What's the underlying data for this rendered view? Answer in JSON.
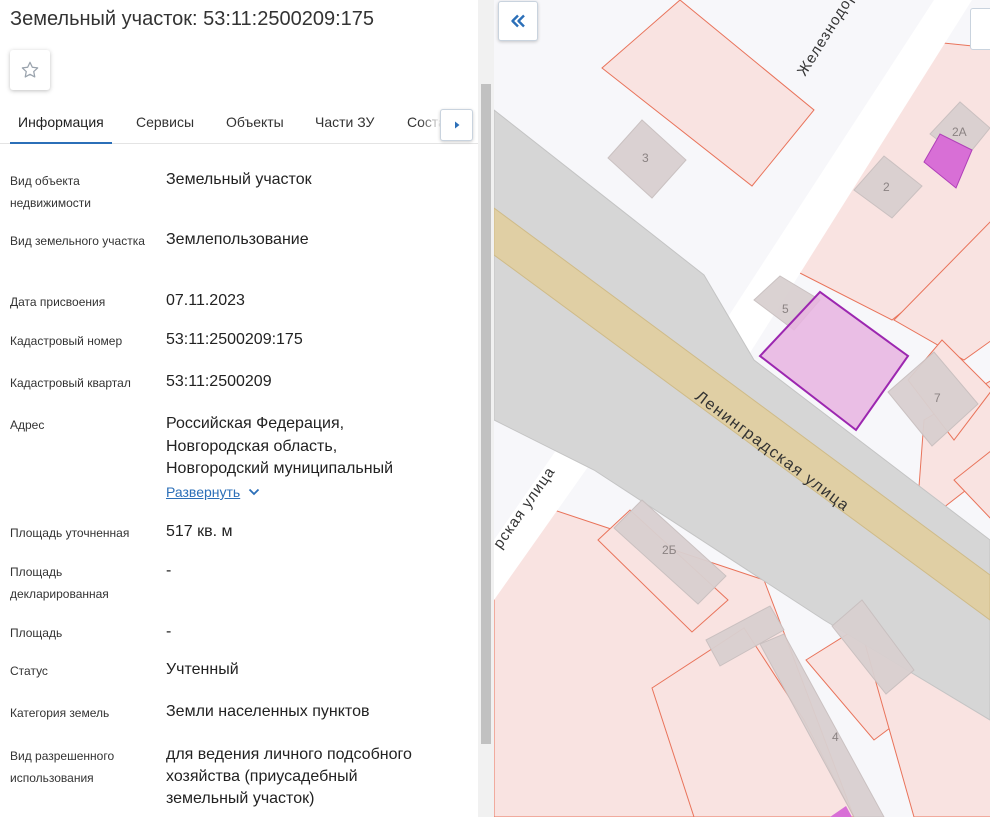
{
  "header": {
    "title": "Земельный участок: 53:11:2500209:175"
  },
  "tabs": [
    {
      "label": "Информация",
      "active": true
    },
    {
      "label": "Сервисы",
      "active": false
    },
    {
      "label": "Объекты",
      "active": false
    },
    {
      "label": "Части ЗУ",
      "active": false
    },
    {
      "label": "Соста",
      "active": false
    }
  ],
  "info": {
    "object_type_label": "Вид объекта недвижимости",
    "object_type_value": "Земельный участок",
    "plot_type_label": "Вид земельного участка",
    "plot_type_value": "Землепользование",
    "date_label": "Дата присвоения",
    "date_value": "07.11.2023",
    "cadastral_number_label": "Кадастровый номер",
    "cadastral_number_value": "53:11:2500209:175",
    "cadastral_quarter_label": "Кадастровый квартал",
    "cadastral_quarter_value": "53:11:2500209",
    "address_label": "Адрес",
    "address_line1": "Российская Федерация,",
    "address_line2": "Новгородская область,",
    "address_line3": "Новгородский муниципальный",
    "expand_label": "Развернуть",
    "area_refined_label": "Площадь уточненная",
    "area_refined_value": "517 кв. м",
    "area_declared_label": "Площадь декларированная",
    "area_declared_value": "-",
    "area_label": "Площадь",
    "area_value": "-",
    "status_label": "Статус",
    "status_value": "Учтенный",
    "land_category_label": "Категория земель",
    "land_category_value": "Земли населенных пунктов",
    "permitted_use_label": "Вид разрешенного использования",
    "permitted_use_line1": "для ведения личного подсобного",
    "permitted_use_line2": "хозяйства (приусадебный",
    "permitted_use_line3": "земельный участок)"
  },
  "map": {
    "street_railway": "Железнодорожная ул",
    "street_leningradskaya": "Ленинградская улица",
    "street_left": "рская улица",
    "house_3": "3",
    "house_2": "2",
    "house_2a": "2А",
    "house_5": "5",
    "house_7": "7",
    "house_2b": "2Б",
    "house_4": "4",
    "colors": {
      "parcel_fill": "#f9e3e1",
      "parcel_border": "#e9735a",
      "building_fill": "#d9d0d0",
      "road_fill": "#d6d6d6",
      "main_road": "#e0cfa4",
      "selected_fill": "#e8b4e0",
      "selected_border": "#9c27b0",
      "highlight_fill": "#d86fd6"
    }
  }
}
